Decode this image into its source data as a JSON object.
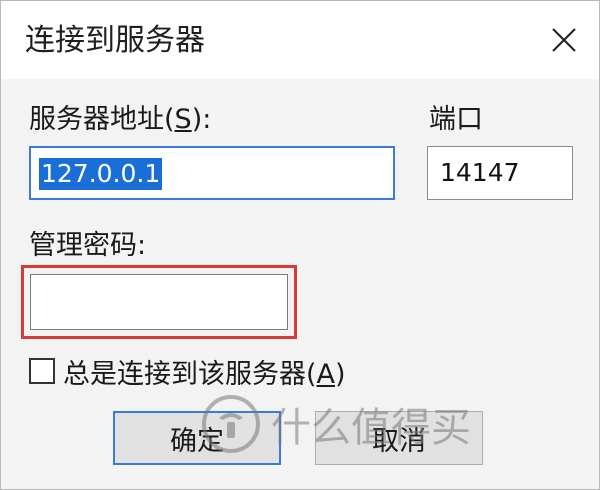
{
  "window": {
    "title": "连接到服务器"
  },
  "server": {
    "label": "服务器地址",
    "mnemonic": "S",
    "value": "127.0.0.1"
  },
  "port": {
    "label": "端口",
    "value": "14147"
  },
  "password": {
    "label": "管理密码:",
    "value": ""
  },
  "always_connect": {
    "label": "总是连接到该服务器",
    "mnemonic": "A",
    "checked": false
  },
  "buttons": {
    "ok": "确定",
    "cancel": "取消"
  },
  "watermark": {
    "text": "什么值得买"
  },
  "colors": {
    "selection": "#1a6fd6",
    "highlight_border": "#d83a3a",
    "focus_border": "#3b7ad6"
  },
  "icons": {
    "close": "close-icon",
    "checkbox": "checkbox-icon",
    "watermark_logo": "smzdm-logo-icon"
  }
}
